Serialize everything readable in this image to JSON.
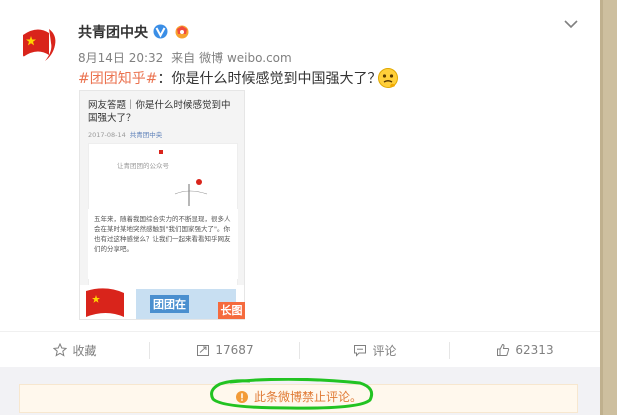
{
  "post": {
    "author": "共青团中央",
    "timestamp": "8月14日 20:32",
    "source_prefix": "来自",
    "source_name": "微博 weibo.com",
    "topic_tag": "#团团知乎#",
    "text": "：你是什么时候感觉到中国强大了？",
    "icons": {
      "verified": "verified-icon",
      "vip": "vip-icon",
      "menu": "chevron-down-icon",
      "emoji": "thinking-emoji-icon"
    }
  },
  "thumbnail": {
    "title": "网友答题｜你是什么时候感觉到中国强大了？",
    "date": "2017-08-14",
    "source": "共青团中央",
    "caption": "让青团团的公众号",
    "paragraph": "五年来，随着我国综合实力的不断显现，很多人会在某时某地突然感触到\"我们国家强大了\"。你也有过这种感觉么？让我们一起来看看知乎网友们的分享吧。",
    "banner_text": "团团在",
    "badge": "长图"
  },
  "actions": {
    "favorite": {
      "label": "收藏",
      "icon": "star-icon"
    },
    "forward": {
      "label": "17687",
      "icon": "forward-icon"
    },
    "comment": {
      "label": "评论",
      "icon": "comment-icon"
    },
    "like": {
      "label": "62313",
      "icon": "thumbs-up-icon"
    }
  },
  "comment_notice": {
    "text": "此条微博禁止评论。",
    "icon": "warning-icon"
  },
  "colors": {
    "topic": "#eb7350",
    "notice_text": "#e07b36",
    "verified": "#f7a22d",
    "highlight_ring": "#22c322",
    "badge": "#f56b3e"
  }
}
